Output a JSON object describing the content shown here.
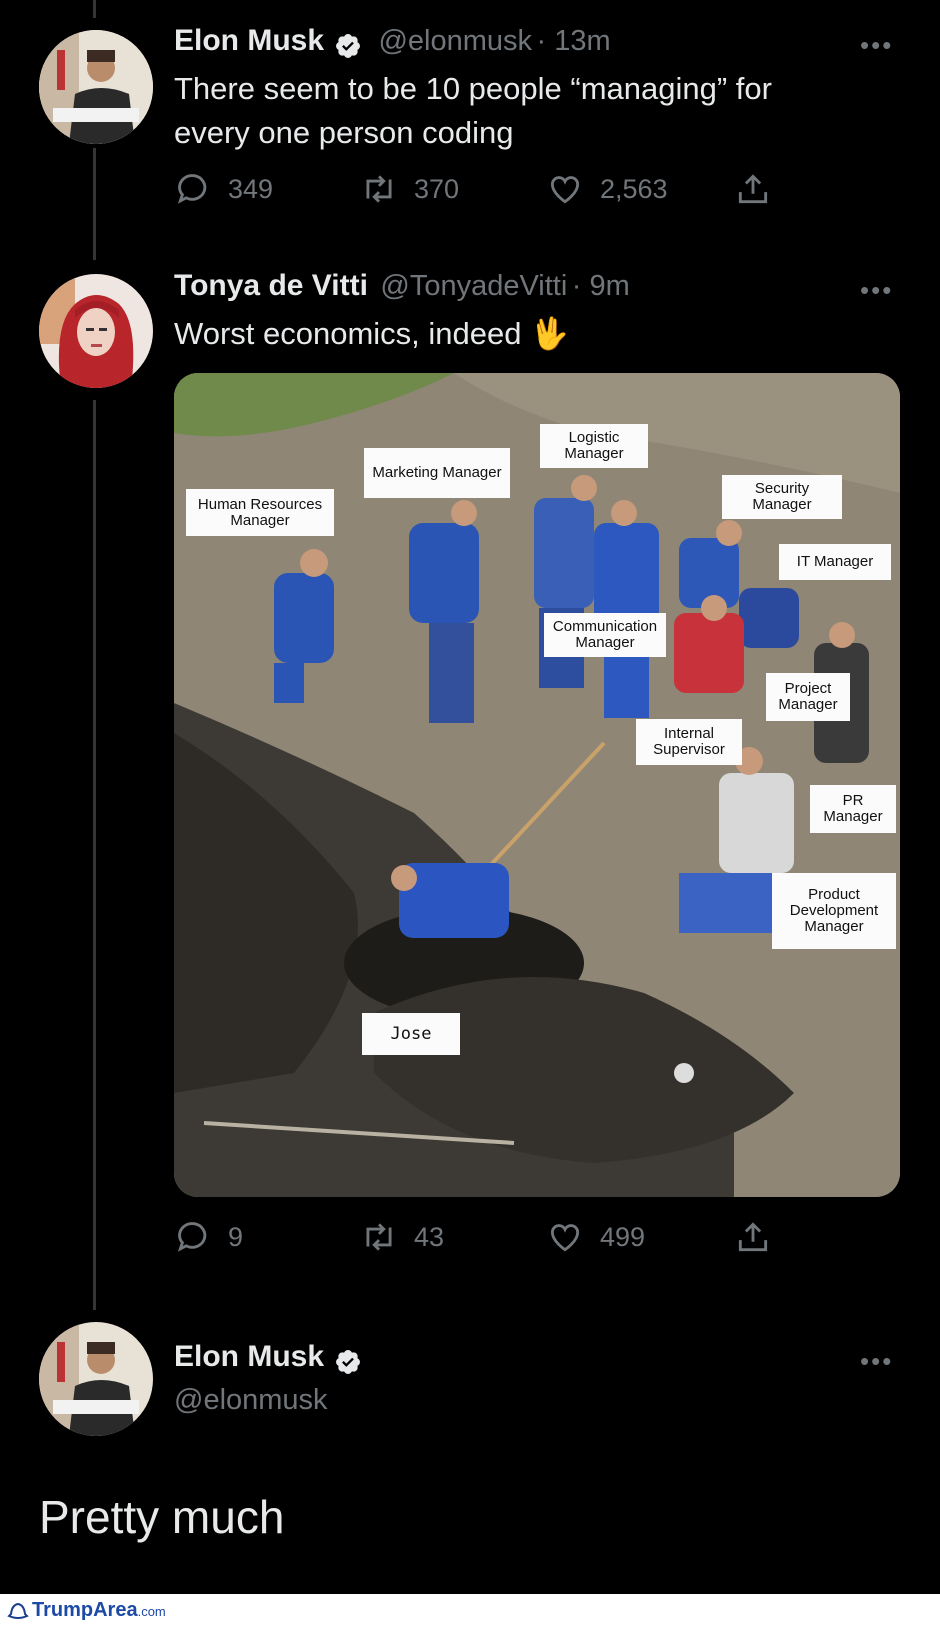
{
  "tweet1": {
    "name": "Elon Musk",
    "handle": "@elonmusk",
    "time": "· 13m",
    "text": "There seem to be 10 people “managing” for every one person coding",
    "replies": "349",
    "retweets": "370",
    "likes": "2,563"
  },
  "tweet2": {
    "name": "Tonya de Vitti",
    "handle": "@TonyadeVitti",
    "time": "· 9m",
    "text": "Worst economics, indeed",
    "emoji": "🖖",
    "replies": "9",
    "retweets": "43",
    "likes": "499",
    "image_labels": {
      "hr": "Human Resources Manager",
      "marketing": "Marketing Manager",
      "logistic": "Logistic Manager",
      "security": "Security Manager",
      "it": "IT Manager",
      "communication": "Communication Manager",
      "project": "Project Manager",
      "internal": "Internal Supervisor",
      "pr": "PR Manager",
      "product": "Product Development Manager",
      "jose": "Jose"
    }
  },
  "tweet3": {
    "name": "Elon Musk",
    "handle": "@elonmusk",
    "text": "Pretty much"
  },
  "watermark": {
    "brand": "TrumpArea",
    "suffix": ".com"
  },
  "colors": {
    "background": "#000000",
    "text": "#e7e9ea",
    "muted": "#71767b",
    "verified": "#e7e9ea"
  }
}
